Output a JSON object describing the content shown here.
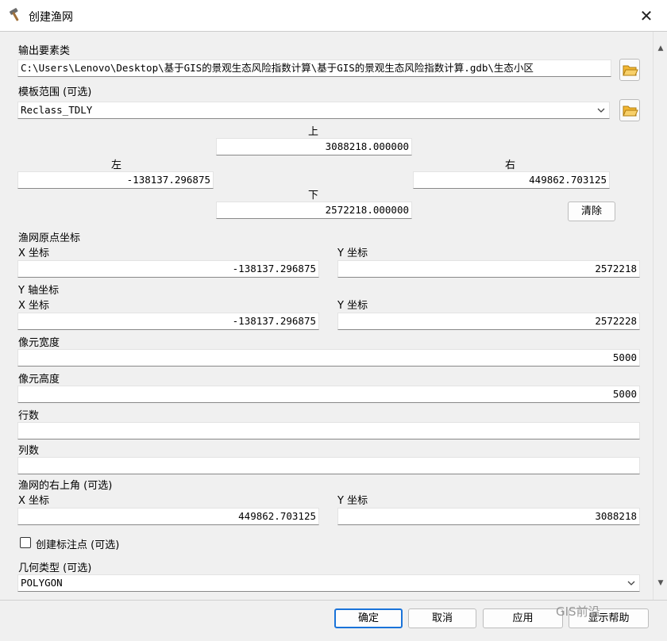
{
  "window": {
    "title": "创建渔网",
    "close_glyph": "✕"
  },
  "output": {
    "label": "输出要素类",
    "path": "C:\\Users\\Lenovo\\Desktop\\基于GIS的景观生态风险指数计算\\基于GIS的景观生态风险指数计算.gdb\\生态小区"
  },
  "template": {
    "label": "模板范围 (可选)",
    "selected": "Reclass_TDLY",
    "top_label": "上",
    "top_value": "3088218.000000",
    "left_label": "左",
    "left_value": "-138137.296875",
    "right_label": "右",
    "right_value": "449862.703125",
    "bottom_label": "下",
    "bottom_value": "2572218.000000",
    "clear_label": "清除"
  },
  "origin": {
    "label": "渔网原点坐标",
    "x_label": "X 坐标",
    "x_value": "-138137.296875",
    "y_label": "Y 坐标",
    "y_value": "2572218"
  },
  "y_axis": {
    "label": "Y 轴坐标",
    "x_label": "X 坐标",
    "x_value": "-138137.296875",
    "y_label": "Y 坐标",
    "y_value": "2572228"
  },
  "cell_width": {
    "label": "像元宽度",
    "value": "5000"
  },
  "cell_height": {
    "label": "像元高度",
    "value": "5000"
  },
  "rows": {
    "label": "行数",
    "value": ""
  },
  "cols": {
    "label": "列数",
    "value": ""
  },
  "corner": {
    "label": "渔网的右上角 (可选)",
    "x_label": "X 坐标",
    "x_value": "449862.703125",
    "y_label": "Y 坐标",
    "y_value": "3088218"
  },
  "labels_checkbox": {
    "label": "创建标注点 (可选)",
    "checked": false
  },
  "geometry": {
    "label": "几何类型 (可选)",
    "selected": "POLYGON"
  },
  "buttons": {
    "ok": "确定",
    "cancel": "取消",
    "apply": "应用",
    "help": "显示帮助"
  },
  "watermark": "GIS前沿",
  "colors": {
    "accent": "#1a73d9",
    "folder": "#f2b632"
  },
  "icons": {
    "app": "hammer-icon",
    "folder": "open-folder-icon",
    "dropdown": "chevron-down-icon",
    "close": "close-icon"
  }
}
